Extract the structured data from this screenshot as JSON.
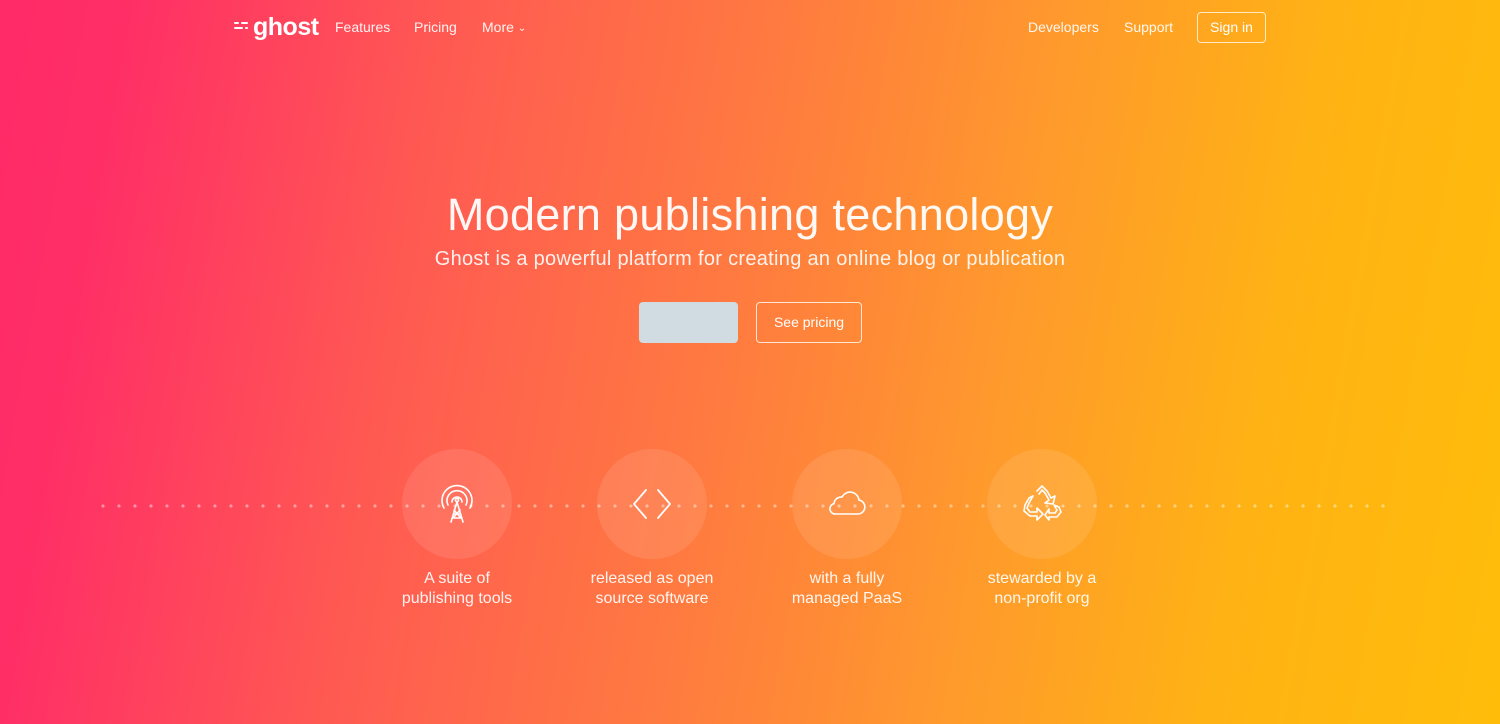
{
  "nav": {
    "logo_text": "ghost",
    "links": [
      "Features",
      "Pricing",
      "More"
    ],
    "right_links": [
      "Developers",
      "Support"
    ],
    "signin_label": "Sign in"
  },
  "hero": {
    "title": "Modern publishing technology",
    "subtitle": "Ghost is a powerful platform for creating an online blog or publication",
    "primary_button_label": "",
    "secondary_button_label": "See pricing"
  },
  "features": [
    {
      "icon": "broadcast-tower-icon",
      "line1": "A suite of",
      "line2": "publishing tools"
    },
    {
      "icon": "code-brackets-icon",
      "line1": "released as open",
      "line2": "source software"
    },
    {
      "icon": "cloud-icon",
      "line1": "with a fully",
      "line2": "managed PaaS"
    },
    {
      "icon": "recycle-icon",
      "line1": "stewarded by a",
      "line2": "non-profit org"
    }
  ],
  "colors": {
    "gradient_start": "#ff2a68",
    "gradient_end": "#ffbd0a",
    "primary_button_bg": "#d1dce2"
  }
}
